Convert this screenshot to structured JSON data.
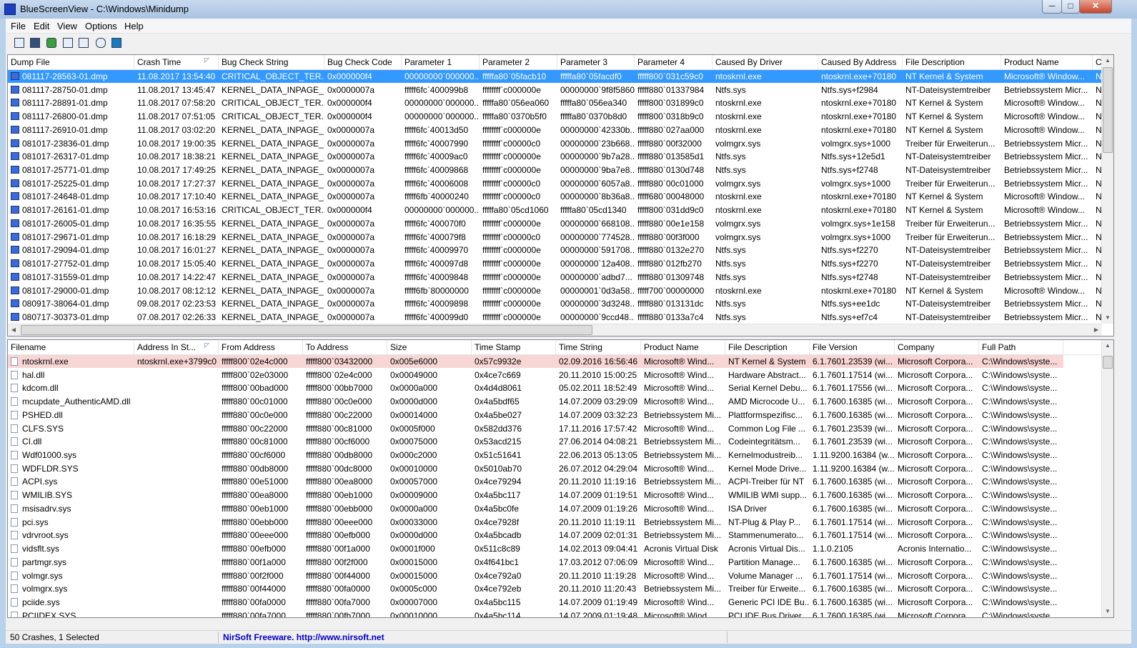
{
  "window": {
    "title": "BlueScreenView  -  C:\\Windows\\Minidump",
    "controls": {
      "minimize": "─",
      "maximize": "□",
      "close": "✕"
    }
  },
  "menu": [
    "File",
    "Edit",
    "View",
    "Options",
    "Help"
  ],
  "toolbar": [
    {
      "icon": "properties-list-icon"
    },
    {
      "icon": "save-icon"
    },
    {
      "icon": "refresh-icon"
    },
    {
      "icon": "copy-icon"
    },
    {
      "icon": "properties-icon"
    },
    {
      "icon": "find-icon"
    },
    {
      "icon": "exit-icon"
    }
  ],
  "crashes": {
    "columns": [
      "Dump File",
      "Crash Time",
      "Bug Check String",
      "Bug Check Code",
      "Parameter 1",
      "Parameter 2",
      "Parameter 3",
      "Parameter 4",
      "Caused By Driver",
      "Caused By Address",
      "File Description",
      "Product Name",
      "C"
    ],
    "sort_icon": "sort-descending-icon",
    "rows": [
      [
        "081117-28563-01.dmp",
        "11.08.2017 13:54:40",
        "CRITICAL_OBJECT_TER...",
        "0x000000f4",
        "00000000`000000...",
        "fffffa80`05facb10",
        "fffffa80`05facdf0",
        "fffff800`031c59c0",
        "ntoskrnl.exe",
        "ntoskrnl.exe+70180",
        "NT Kernel & System",
        "Microsoft® Window...",
        "N"
      ],
      [
        "081117-28750-01.dmp",
        "11.08.2017 13:45:47",
        "KERNEL_DATA_INPAGE_...",
        "0x0000007a",
        "fffff6fc`400099b8",
        "ffffffff`c000000e",
        "00000000`9f8f5860",
        "fffff880`01337984",
        "Ntfs.sys",
        "Ntfs.sys+f2984",
        "NT-Dateisystemtreiber",
        "Betriebssystem Micr...",
        "N"
      ],
      [
        "081117-28891-01.dmp",
        "11.08.2017 07:58:20",
        "CRITICAL_OBJECT_TER...",
        "0x000000f4",
        "00000000`000000...",
        "fffffa80`056ea060",
        "fffffa80`056ea340",
        "fffff800`031899c0",
        "ntoskrnl.exe",
        "ntoskrnl.exe+70180",
        "NT Kernel & System",
        "Microsoft® Window...",
        "N"
      ],
      [
        "081117-26800-01.dmp",
        "11.08.2017 07:51:05",
        "CRITICAL_OBJECT_TER...",
        "0x000000f4",
        "00000000`000000...",
        "fffffa80`0370b5f0",
        "fffffa80`0370b8d0",
        "fffff800`0318b9c0",
        "ntoskrnl.exe",
        "ntoskrnl.exe+70180",
        "NT Kernel & System",
        "Microsoft® Window...",
        "N"
      ],
      [
        "081117-26910-01.dmp",
        "11.08.2017 03:02:20",
        "KERNEL_DATA_INPAGE_...",
        "0x0000007a",
        "fffff6fc`40013d50",
        "ffffffff`c000000e",
        "00000000`42330b...",
        "fffff880`027aa000",
        "ntoskrnl.exe",
        "ntoskrnl.exe+70180",
        "NT Kernel & System",
        "Microsoft® Window...",
        "N"
      ],
      [
        "081017-23836-01.dmp",
        "10.08.2017 19:00:35",
        "KERNEL_DATA_INPAGE_...",
        "0x0000007a",
        "fffff6fc`40007990",
        "ffffffff`c00000c0",
        "00000000`23b668...",
        "fffff880`00f32000",
        "volmgrx.sys",
        "volmgrx.sys+1000",
        "Treiber für Erweiterun...",
        "Betriebssystem Micr...",
        "N"
      ],
      [
        "081017-26317-01.dmp",
        "10.08.2017 18:38:21",
        "KERNEL_DATA_INPAGE_...",
        "0x0000007a",
        "fffff6fc`40009ac0",
        "ffffffff`c000000e",
        "00000000`9b7a28...",
        "fffff880`013585d1",
        "Ntfs.sys",
        "Ntfs.sys+12e5d1",
        "NT-Dateisystemtreiber",
        "Betriebssystem Micr...",
        "N"
      ],
      [
        "081017-25771-01.dmp",
        "10.08.2017 17:49:25",
        "KERNEL_DATA_INPAGE_...",
        "0x0000007a",
        "fffff6fc`40009868",
        "ffffffff`c000000e",
        "00000000`9ba7e8...",
        "fffff880`0130d748",
        "Ntfs.sys",
        "Ntfs.sys+f2748",
        "NT-Dateisystemtreiber",
        "Betriebssystem Micr...",
        "N"
      ],
      [
        "081017-25225-01.dmp",
        "10.08.2017 17:27:37",
        "KERNEL_DATA_INPAGE_...",
        "0x0000007a",
        "fffff6fc`40006008",
        "ffffffff`c00000c0",
        "00000000`6057a8...",
        "fffff880`00c01000",
        "volmgrx.sys",
        "volmgrx.sys+1000",
        "Treiber für Erweiterun...",
        "Betriebssystem Micr...",
        "N"
      ],
      [
        "081017-24648-01.dmp",
        "10.08.2017 17:10:40",
        "KERNEL_DATA_INPAGE_...",
        "0x0000007a",
        "fffff6fb`40000240",
        "ffffffff`c00000c0",
        "00000000`8b36a8...",
        "fffff680`00048000",
        "ntoskrnl.exe",
        "ntoskrnl.exe+70180",
        "NT Kernel & System",
        "Microsoft® Window...",
        "N"
      ],
      [
        "081017-26161-01.dmp",
        "10.08.2017 16:53:16",
        "CRITICAL_OBJECT_TER...",
        "0x000000f4",
        "00000000`000000...",
        "fffffa80`05cd1060",
        "fffffa80`05cd1340",
        "fffff800`031dd9c0",
        "ntoskrnl.exe",
        "ntoskrnl.exe+70180",
        "NT Kernel & System",
        "Microsoft® Window...",
        "N"
      ],
      [
        "081017-26005-01.dmp",
        "10.08.2017 16:35:55",
        "KERNEL_DATA_INPAGE_...",
        "0x0000007a",
        "fffff6fc`400070f0",
        "ffffffff`c000000e",
        "00000000`668108...",
        "fffff880`00e1e158",
        "volmgrx.sys",
        "volmgrx.sys+1e158",
        "Treiber für Erweiterun...",
        "Betriebssystem Micr...",
        "N"
      ],
      [
        "081017-29671-01.dmp",
        "10.08.2017 16:18:29",
        "KERNEL_DATA_INPAGE_...",
        "0x0000007a",
        "fffff6fc`400079f8",
        "ffffffff`c00000c0",
        "00000000`774528...",
        "fffff880`00f3f000",
        "volmgrx.sys",
        "volmgrx.sys+1000",
        "Treiber für Erweiterun...",
        "Betriebssystem Micr...",
        "N"
      ],
      [
        "081017-29094-01.dmp",
        "10.08.2017 16:01:27",
        "KERNEL_DATA_INPAGE_...",
        "0x0000007a",
        "fffff6fc`40009970",
        "ffffffff`c000000e",
        "00000000`591708...",
        "fffff880`0132e270",
        "Ntfs.sys",
        "Ntfs.sys+f2270",
        "NT-Dateisystemtreiber",
        "Betriebssystem Micr...",
        "N"
      ],
      [
        "081017-27752-01.dmp",
        "10.08.2017 15:05:40",
        "KERNEL_DATA_INPAGE_...",
        "0x0000007a",
        "fffff6fc`400097d8",
        "ffffffff`c000000e",
        "00000000`12a408...",
        "fffff880`012fb270",
        "Ntfs.sys",
        "Ntfs.sys+f2270",
        "NT-Dateisystemtreiber",
        "Betriebssystem Micr...",
        "N"
      ],
      [
        "081017-31559-01.dmp",
        "10.08.2017 14:22:47",
        "KERNEL_DATA_INPAGE_...",
        "0x0000007a",
        "fffff6fc`40009848",
        "ffffffff`c000000e",
        "00000000`adbd7...",
        "fffff880`01309748",
        "Ntfs.sys",
        "Ntfs.sys+f2748",
        "NT-Dateisystemtreiber",
        "Betriebssystem Micr...",
        "N"
      ],
      [
        "081017-29000-01.dmp",
        "10.08.2017 08:12:12",
        "KERNEL_DATA_INPAGE_...",
        "0x0000007a",
        "fffff6fb`80000000",
        "ffffffff`c000000e",
        "00000001`0d3a58...",
        "fffff700`00000000",
        "ntoskrnl.exe",
        "ntoskrnl.exe+70180",
        "NT Kernel & System",
        "Microsoft® Window...",
        "N"
      ],
      [
        "080917-38064-01.dmp",
        "09.08.2017 02:23:53",
        "KERNEL_DATA_INPAGE_...",
        "0x0000007a",
        "fffff6fc`40009898",
        "ffffffff`c000000e",
        "00000000`3d3248...",
        "fffff880`013131dc",
        "Ntfs.sys",
        "Ntfs.sys+ee1dc",
        "NT-Dateisystemtreiber",
        "Betriebssystem Micr...",
        "N"
      ],
      [
        "080717-30373-01.dmp",
        "07.08.2017 02:26:33",
        "KERNEL_DATA_INPAGE_...",
        "0x0000007a",
        "fffff6fc`400099d0",
        "ffffffff`c000000e",
        "00000000`9ccd48...",
        "fffff880`0133a7c4",
        "Ntfs.sys",
        "Ntfs.sys+ef7c4",
        "NT-Dateisystemtreiber",
        "Betriebssystem Micr...",
        "N"
      ]
    ]
  },
  "modules": {
    "columns": [
      "Filename",
      "Address In St...",
      "From Address",
      "To Address",
      "Size",
      "Time Stamp",
      "Time String",
      "Product Name",
      "File Description",
      "File Version",
      "Company",
      "Full Path"
    ],
    "sort_icon": "sort-icon",
    "rows": [
      [
        "ntoskrnl.exe",
        "ntoskrnl.exe+3799c0",
        "fffff800`02e4c000",
        "fffff800`03432000",
        "0x005e6000",
        "0x57c9932e",
        "02.09.2016 16:56:46",
        "Microsoft® Wind...",
        "NT Kernel & System",
        "6.1.7601.23539 (wi...",
        "Microsoft Corpora...",
        "C:\\Windows\\syste..."
      ],
      [
        "hal.dll",
        "",
        "fffff800`02e03000",
        "fffff800`02e4c000",
        "0x00049000",
        "0x4ce7c669",
        "20.11.2010 15:00:25",
        "Microsoft® Wind...",
        "Hardware Abstract...",
        "6.1.7601.17514 (wi...",
        "Microsoft Corpora...",
        "C:\\Windows\\syste..."
      ],
      [
        "kdcom.dll",
        "",
        "fffff800`00bad000",
        "fffff800`00bb7000",
        "0x0000a000",
        "0x4d4d8061",
        "05.02.2011 18:52:49",
        "Microsoft® Wind...",
        "Serial Kernel Debu...",
        "6.1.7601.17556 (wi...",
        "Microsoft Corpora...",
        "C:\\Windows\\syste..."
      ],
      [
        "mcupdate_AuthenticAMD.dll",
        "",
        "fffff880`00c01000",
        "fffff880`00c0e000",
        "0x0000d000",
        "0x4a5bdf65",
        "14.07.2009 03:29:09",
        "Microsoft® Wind...",
        "AMD Microcode U...",
        "6.1.7600.16385 (wi...",
        "Microsoft Corpora...",
        "C:\\Windows\\syste..."
      ],
      [
        "PSHED.dll",
        "",
        "fffff880`00c0e000",
        "fffff880`00c22000",
        "0x00014000",
        "0x4a5be027",
        "14.07.2009 03:32:23",
        "Betriebssystem Mi...",
        "Plattformspezifisc...",
        "6.1.7600.16385 (wi...",
        "Microsoft Corpora...",
        "C:\\Windows\\syste..."
      ],
      [
        "CLFS.SYS",
        "",
        "fffff880`00c22000",
        "fffff880`00c81000",
        "0x0005f000",
        "0x582dd376",
        "17.11.2016 17:57:42",
        "Microsoft® Wind...",
        "Common Log File ...",
        "6.1.7601.23539 (wi...",
        "Microsoft Corpora...",
        "C:\\Windows\\syste..."
      ],
      [
        "CI.dll",
        "",
        "fffff880`00c81000",
        "fffff880`00cf6000",
        "0x00075000",
        "0x53acd215",
        "27.06.2014 04:08:21",
        "Betriebssystem Mi...",
        "Codeintegritätsm...",
        "6.1.7601.23539 (wi...",
        "Microsoft Corpora...",
        "C:\\Windows\\syste..."
      ],
      [
        "Wdf01000.sys",
        "",
        "fffff880`00cf6000",
        "fffff880`00db8000",
        "0x000c2000",
        "0x51c51641",
        "22.06.2013 05:13:05",
        "Betriebssystem Mi...",
        "Kernelmodustreib...",
        "1.11.9200.16384 (w...",
        "Microsoft Corpora...",
        "C:\\Windows\\syste..."
      ],
      [
        "WDFLDR.SYS",
        "",
        "fffff880`00db8000",
        "fffff880`00dc8000",
        "0x00010000",
        "0x5010ab70",
        "26.07.2012 04:29:04",
        "Microsoft® Wind...",
        "Kernel Mode Drive...",
        "1.11.9200.16384 (w...",
        "Microsoft Corpora...",
        "C:\\Windows\\syste..."
      ],
      [
        "ACPI.sys",
        "",
        "fffff880`00e51000",
        "fffff880`00ea8000",
        "0x00057000",
        "0x4ce79294",
        "20.11.2010 11:19:16",
        "Betriebssystem Mi...",
        "ACPI-Treiber für NT",
        "6.1.7600.16385 (wi...",
        "Microsoft Corpora...",
        "C:\\Windows\\syste..."
      ],
      [
        "WMILIB.SYS",
        "",
        "fffff880`00ea8000",
        "fffff880`00eb1000",
        "0x00009000",
        "0x4a5bc117",
        "14.07.2009 01:19:51",
        "Microsoft® Wind...",
        "WMILIB WMI supp...",
        "6.1.7600.16385 (wi...",
        "Microsoft Corpora...",
        "C:\\Windows\\syste..."
      ],
      [
        "msisadrv.sys",
        "",
        "fffff880`00eb1000",
        "fffff880`00ebb000",
        "0x0000a000",
        "0x4a5bc0fe",
        "14.07.2009 01:19:26",
        "Microsoft® Wind...",
        "ISA Driver",
        "6.1.7600.16385 (wi...",
        "Microsoft Corpora...",
        "C:\\Windows\\syste..."
      ],
      [
        "pci.sys",
        "",
        "fffff880`00ebb000",
        "fffff880`00eee000",
        "0x00033000",
        "0x4ce7928f",
        "20.11.2010 11:19:11",
        "Betriebssystem Mi...",
        "NT-Plug & Play P...",
        "6.1.7601.17514 (wi...",
        "Microsoft Corpora...",
        "C:\\Windows\\syste..."
      ],
      [
        "vdrvroot.sys",
        "",
        "fffff880`00eee000",
        "fffff880`00efb000",
        "0x0000d000",
        "0x4a5bcadb",
        "14.07.2009 02:01:31",
        "Betriebssystem Mi...",
        "Stammenumerato...",
        "6.1.7601.17514 (wi...",
        "Microsoft Corpora...",
        "C:\\Windows\\syste..."
      ],
      [
        "vidsflt.sys",
        "",
        "fffff880`00efb000",
        "fffff880`00f1a000",
        "0x0001f000",
        "0x511c8c89",
        "14.02.2013 09:04:41",
        "Acronis Virtual Disk",
        "Acronis Virtual Dis...",
        "1.1.0.2105",
        "Acronis Internatio...",
        "C:\\Windows\\syste..."
      ],
      [
        "partmgr.sys",
        "",
        "fffff880`00f1a000",
        "fffff880`00f2f000",
        "0x00015000",
        "0x4f641bc1",
        "17.03.2012 07:06:09",
        "Microsoft® Wind...",
        "Partition Manage...",
        "6.1.7600.16385 (wi...",
        "Microsoft Corpora...",
        "C:\\Windows\\syste..."
      ],
      [
        "volmgr.sys",
        "",
        "fffff880`00f2f000",
        "fffff880`00f44000",
        "0x00015000",
        "0x4ce792a0",
        "20.11.2010 11:19:28",
        "Microsoft® Wind...",
        "Volume Manager ...",
        "6.1.7601.17514 (wi...",
        "Microsoft Corpora...",
        "C:\\Windows\\syste..."
      ],
      [
        "volmgrx.sys",
        "",
        "fffff880`00f44000",
        "fffff880`00fa0000",
        "0x0005c000",
        "0x4ce792eb",
        "20.11.2010 11:20:43",
        "Betriebssystem Mi...",
        "Treiber für Erweite...",
        "6.1.7600.16385 (wi...",
        "Microsoft Corpora...",
        "C:\\Windows\\syste..."
      ],
      [
        "pciide.sys",
        "",
        "fffff880`00fa0000",
        "fffff880`00fa7000",
        "0x00007000",
        "0x4a5bc115",
        "14.07.2009 01:19:49",
        "Microsoft® Wind...",
        "Generic PCI IDE Bu...",
        "6.1.7600.16385 (wi...",
        "Microsoft Corpora...",
        "C:\\Windows\\syste..."
      ],
      [
        "PCIIDEX.SYS",
        "",
        "fffff880`00fa7000",
        "fffff880`00fb7000",
        "0x00010000",
        "0x4a5bc114",
        "14.07.2009 01:19:48",
        "Microsoft® Wind...",
        "PCI IDE Bus Driver",
        "6.1.7600.16385 (wi...",
        "Microsoft Corpora...",
        "C:\\Windows\\syste..."
      ]
    ]
  },
  "status": {
    "summary": "50 Crashes, 1 Selected",
    "link": "NirSoft Freeware.  http://www.nirsoft.net"
  },
  "colors": {
    "selected_row": "#3399ff",
    "highlighted_module": "#f7d6d6",
    "link": "#0000cc"
  }
}
